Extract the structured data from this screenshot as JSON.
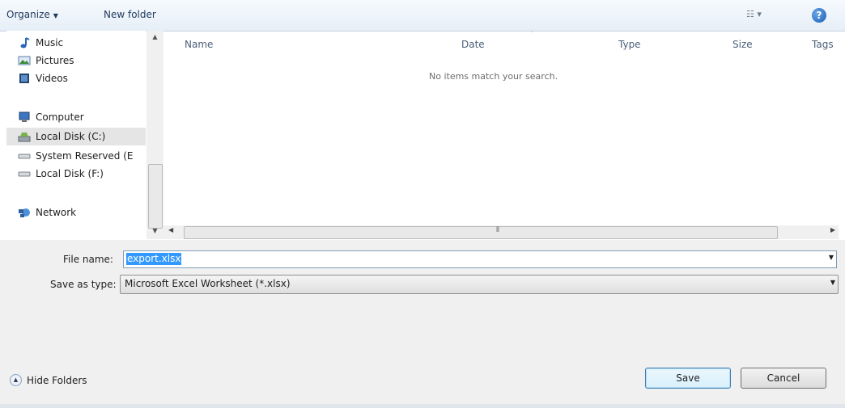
{
  "toolbar": {
    "organize_label": "Organize",
    "new_folder_label": "New folder",
    "views_icon": "views-icon",
    "help_icon": "help-icon"
  },
  "nav": {
    "items": [
      {
        "label": "Music",
        "icon": "music-icon"
      },
      {
        "label": "Pictures",
        "icon": "pictures-icon"
      },
      {
        "label": "Videos",
        "icon": "videos-icon"
      },
      {
        "label": "Computer",
        "icon": "computer-icon"
      },
      {
        "label": "Local Disk (C:)",
        "icon": "drive-c-icon",
        "selected": true
      },
      {
        "label": "System Reserved (E",
        "icon": "drive-icon"
      },
      {
        "label": "Local Disk (F:)",
        "icon": "drive-icon"
      },
      {
        "label": "Network",
        "icon": "network-icon"
      }
    ]
  },
  "columns": [
    "Name",
    "Date",
    "Type",
    "Size",
    "Tags"
  ],
  "empty_message": "No items match your search.",
  "form": {
    "file_name_label": "File name:",
    "file_name_value": "export.xlsx",
    "save_type_label": "Save as type:",
    "save_type_value": "Microsoft Excel Worksheet (*.xlsx)"
  },
  "footer": {
    "hide_folders_label": "Hide Folders",
    "save_label": "Save",
    "cancel_label": "Cancel"
  },
  "colors": {
    "selection": "#3399ff",
    "toolbar_text": "#1e395b"
  }
}
